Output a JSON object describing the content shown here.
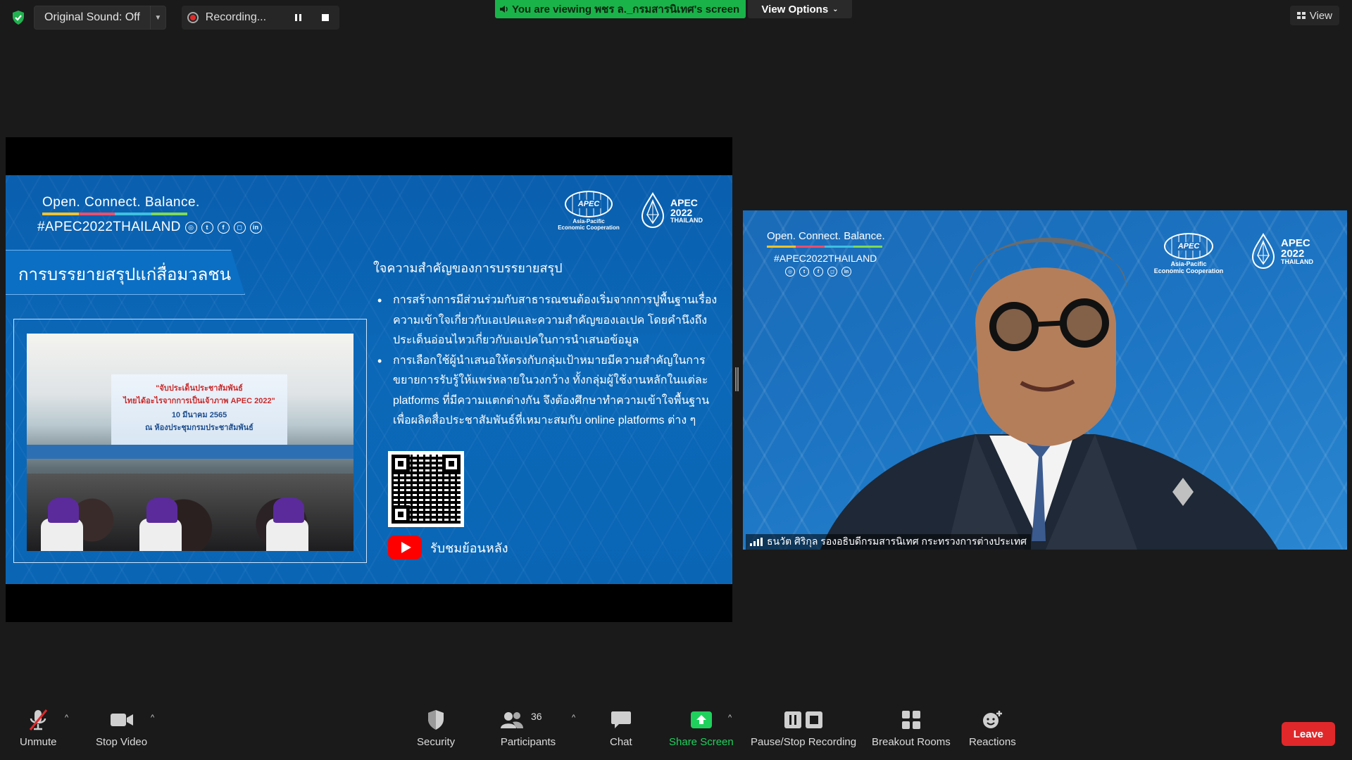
{
  "top_bar": {
    "original_sound_label": "Original Sound: Off",
    "recording_label": "Recording...",
    "viewing_banner": "You are viewing พชร ล._กรมสารนิเทศ's screen",
    "view_options_label": "View Options",
    "view_label": "View"
  },
  "slide": {
    "slogan": "Open. Connect. Balance.",
    "hashtag": "#APEC2022THAILAND",
    "apec_globe_text": "APEC",
    "apec_caption_line1": "Asia-Pacific",
    "apec_caption_line2": "Economic Cooperation",
    "apec2022_line1": "APEC",
    "apec2022_line2": "2022",
    "apec2022_line3": "THAILAND",
    "title": "การบรรยายสรุปแก่สื่อมวลชน",
    "heading": "ใจความสำคัญของการบรรยายสรุป",
    "bullets": [
      "การสร้างการมีส่วนร่วมกับสาธารณชนต้องเริ่มจากการปูพื้นฐานเรื่องความเข้าใจเกี่ยวกับเอเปคและความสำคัญของเอเปค โดยคำนึงถึงประเด็นอ่อนไหวเกี่ยวกับเอเปคในการนำเสนอข้อมูล",
      "การเลือกใช้ผู้นำเสนอให้ตรงกับกลุ่มเป้าหมายมีความสำคัญในการขยายการรับรู้ให้แพร่หลายในวงกว้าง ทั้งกลุ่มผู้ใช้งานหลักในแต่ละ platforms ที่มีความแตกต่างกัน จึงต้องศึกษาทำความเข้าใจพื้นฐาน เพื่อผลิตสื่อประชาสัมพันธ์ที่เหมาะสมกับ online platforms ต่าง ๆ"
    ],
    "photo_banner_line1": "\"จับประเด็นประชาสัมพันธ์",
    "photo_banner_line2": "ไทยได้อะไรจากการเป็นเจ้าภาพ APEC 2022\"",
    "photo_banner_line3": "10 มีนาคม 2565",
    "photo_banner_line4": "ณ ห้องประชุมกรมประชาสัมพันธ์",
    "youtube_text": "รับชมย้อนหลัง"
  },
  "speaker": {
    "slogan": "Open. Connect. Balance.",
    "hashtag": "#APEC2022THAILAND",
    "apec_globe_text": "APEC",
    "apec_caption_line1": "Asia-Pacific",
    "apec_caption_line2": "Economic Cooperation",
    "apec2022_line1": "APEC",
    "apec2022_line2": "2022",
    "apec2022_line3": "THAILAND",
    "name": "ธนวัต ศิริกุล รองอธิบดีกรมสารนิเทศ กระทรวงการต่างประเทศ"
  },
  "toolbar": {
    "unmute": "Unmute",
    "stop_video": "Stop Video",
    "security": "Security",
    "participants": "Participants",
    "participants_count": "36",
    "chat": "Chat",
    "share_screen": "Share Screen",
    "pause_stop_recording": "Pause/Stop Recording",
    "breakout_rooms": "Breakout Rooms",
    "reactions": "Reactions",
    "leave": "Leave"
  },
  "colors": {
    "accent_green": "#1fd15c",
    "leave_red": "#e0282b",
    "slide_blue": "#0a5fae"
  }
}
